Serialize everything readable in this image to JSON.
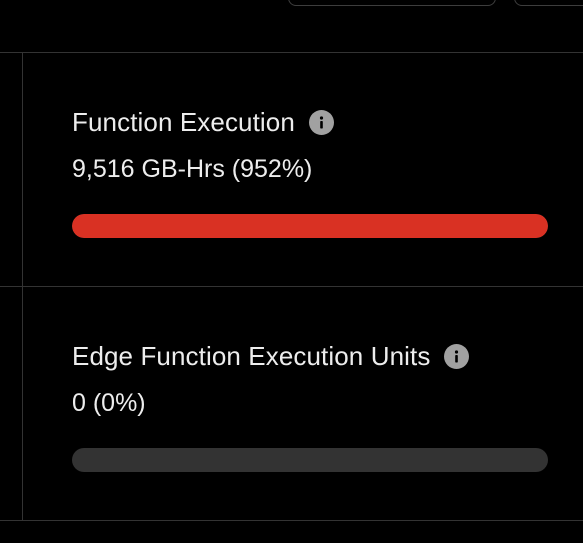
{
  "metrics": [
    {
      "title": "Function Execution",
      "value": "9,516 GB-Hrs (952%)",
      "usage_percent": 952,
      "fill_fraction": 1.0,
      "bar_color": "#d93123",
      "info_icon": "info-icon"
    },
    {
      "title": "Edge Function Execution Units",
      "value": "0 (0%)",
      "usage_percent": 0,
      "fill_fraction": 0.0,
      "bar_color": "#d93123",
      "info_icon": "info-icon"
    }
  ],
  "colors": {
    "background": "#000000",
    "border": "#333333",
    "text": "#ededed",
    "track": "#333333",
    "over_limit": "#d93123"
  }
}
